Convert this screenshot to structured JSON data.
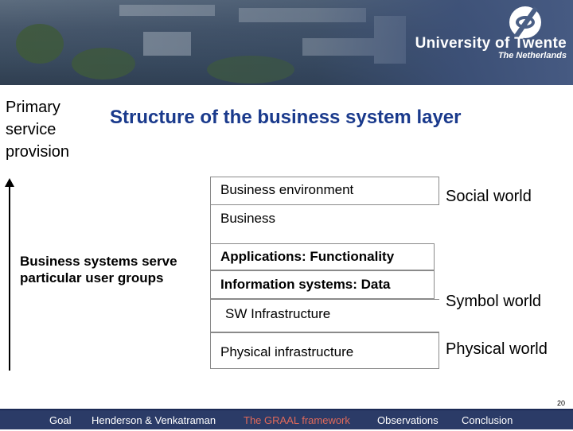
{
  "header": {
    "university": "University of Twente",
    "country": "The Netherlands"
  },
  "left_label": "Primary service provision",
  "title": "Structure of the business system layer",
  "layers": {
    "business_environment": "Business environment",
    "business": "Business",
    "applications": "Applications: Functionality",
    "information_systems": "Information systems: Data",
    "sw_infrastructure": "SW Infrastructure",
    "physical_infrastructure": "Physical infrastructure"
  },
  "annotation": "Business systems serve particular user groups",
  "worlds": {
    "social": "Social world",
    "symbol": "Symbol world",
    "physical": "Physical world"
  },
  "page_number": "20",
  "footer": {
    "items": [
      {
        "label": "Goal",
        "active": false
      },
      {
        "label": "Henderson & Venkatraman",
        "active": false
      },
      {
        "label": "The GRAAL framework",
        "active": true
      },
      {
        "label": "Observations",
        "active": false
      },
      {
        "label": "Conclusion",
        "active": false
      }
    ]
  },
  "colors": {
    "title": "#1a3a8c",
    "footer_bg": "#2b3b67",
    "footer_active": "#e06a5a"
  }
}
